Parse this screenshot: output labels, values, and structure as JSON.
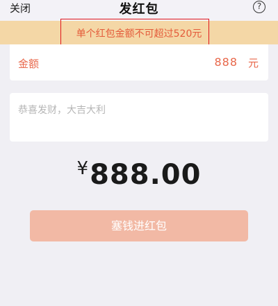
{
  "nav": {
    "close_label": "关闭",
    "title": "发红包",
    "help_icon": "question-circle-icon",
    "help_glyph": "?"
  },
  "warning": {
    "text": "单个红包金额不可超过520元",
    "background": "#f4d7a6",
    "text_color": "#e45b3a",
    "highlight_color": "#e0151a"
  },
  "amount": {
    "label": "金额",
    "value": "888",
    "unit": "元",
    "color": "#e8674a"
  },
  "message": {
    "placeholder": "恭喜发财，大吉大利"
  },
  "total": {
    "currency_symbol": "¥",
    "amount": "888.00"
  },
  "send_button": {
    "label": "塞钱进红包",
    "color": "#f2b9a5"
  }
}
